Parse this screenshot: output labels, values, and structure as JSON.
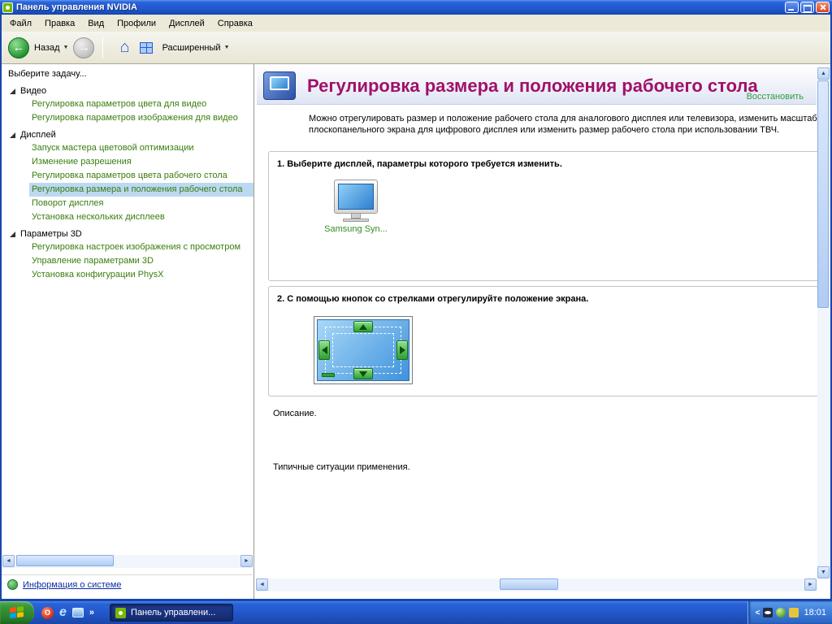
{
  "window": {
    "title": "Панель управления NVIDIA"
  },
  "menubar": {
    "items": [
      "Файл",
      "Правка",
      "Вид",
      "Профили",
      "Дисплей",
      "Справка"
    ]
  },
  "toolbar": {
    "back_label": "Назад",
    "view_mode_label": "Расширенный"
  },
  "sidebar": {
    "header": "Выберите задачу...",
    "groups": [
      {
        "label": "Видео",
        "items": [
          "Регулировка параметров цвета для видео",
          "Регулировка параметров изображения для видео"
        ]
      },
      {
        "label": "Дисплей",
        "items": [
          "Запуск мастера цветовой оптимизации",
          "Изменение разрешения",
          "Регулировка параметров цвета рабочего стола",
          "Регулировка размера и положения рабочего стола",
          "Поворот дисплея",
          "Установка нескольких дисплеев"
        ]
      },
      {
        "label": "Параметры 3D",
        "items": [
          "Регулировка настроек изображения с просмотром",
          "Управление параметрами 3D",
          "Установка конфигурации PhysX"
        ]
      }
    ],
    "selected_item": "Регулировка размера и положения рабочего стола",
    "system_info_link": "Информация о системе"
  },
  "content": {
    "page_title": "Регулировка размера и положения рабочего стола",
    "restore_link": "Восстановить",
    "intro": "Можно отрегулировать размер и положение рабочего стола для аналогового дисплея или телевизора, изменить масштаб плоскопанельного экрана для цифрового дисплея или изменить размер рабочего стола при использовании ТВЧ.",
    "step1_heading": "1. Выберите дисплей, параметры которого требуется изменить.",
    "display_label": "Samsung Syn...",
    "step2_heading": "2. С помощью кнопок со стрелками отрегулируйте положение экрана.",
    "description_label": "Описание.",
    "scenarios_label": "Типичные ситуации применения."
  },
  "taskbar": {
    "task_button_label": "Панель управлени...",
    "clock": "18:01",
    "quicklaunch_overflow": "»",
    "tray_collapse": "<",
    "opera_glyph": "O",
    "ie_glyph": "e"
  },
  "glyphs": {
    "dropdown": "▼",
    "back_arrow": "←",
    "forward_arrow": "→",
    "home": "⌂",
    "scroll_left": "◄",
    "scroll_right": "►",
    "scroll_up": "▲",
    "scroll_down": "▼"
  },
  "colors": {
    "title_magenta": "#a01168",
    "nvidia_green_link": "#2f9e3f",
    "tree_link_green": "#3a7d0e",
    "selection_blue": "#bcd9f2",
    "taskbar_blue": "#2156c8",
    "start_green": "#2a7e2a"
  }
}
